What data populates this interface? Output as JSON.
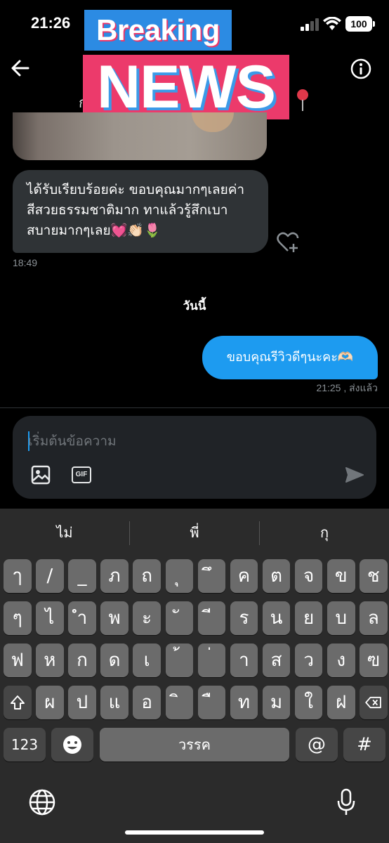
{
  "status_bar": {
    "time": "21:26",
    "battery": "100"
  },
  "header": {
    "name_partial": "ก",
    "pin_emoji": "📍"
  },
  "overlay": {
    "breaking": "Breaking",
    "news": "NEWS"
  },
  "messages": {
    "incoming_text": "ได้รับเรียบร้อยค่ะ ขอบคุณมากๆเลยค่า สีสวยธรรมชาติมาก ทาแล้วรู้สึกเบาสบายมากๆเลย💓👏🏻🌷",
    "incoming_time": "18:49",
    "date_separator": "วันนี้",
    "outgoing_text": "ขอบคุณรีวิวดีๆนะคะ🫶🏻",
    "outgoing_meta": "21:25 , ส่งแล้ว"
  },
  "composer": {
    "placeholder": "เริ่มต้นข้อความ",
    "gif_label": "GIF"
  },
  "keyboard": {
    "suggestions": [
      "ไม่",
      "พี่",
      "กุ"
    ],
    "row1": [
      "ๅ",
      "/",
      "_",
      "ภ",
      "ถ",
      "ุ",
      "ึ",
      "ค",
      "ต",
      "จ",
      "ข",
      "ช"
    ],
    "row2": [
      "ๆ",
      "ไ",
      "ำ",
      "พ",
      "ะ",
      "ั",
      "ี",
      "ร",
      "น",
      "ย",
      "บ",
      "ล"
    ],
    "row3": [
      "ฟ",
      "ห",
      "ก",
      "ด",
      "เ",
      "้",
      "่",
      "า",
      "ส",
      "ว",
      "ง",
      "ฃ"
    ],
    "row4": [
      "ผ",
      "ป",
      "แ",
      "อ",
      "ิ",
      "ื",
      "ท",
      "ม",
      "ใ",
      "ฝ"
    ],
    "numbers_label": "123",
    "space_label": "วรรค",
    "at_label": "@",
    "hash_label": "#"
  }
}
